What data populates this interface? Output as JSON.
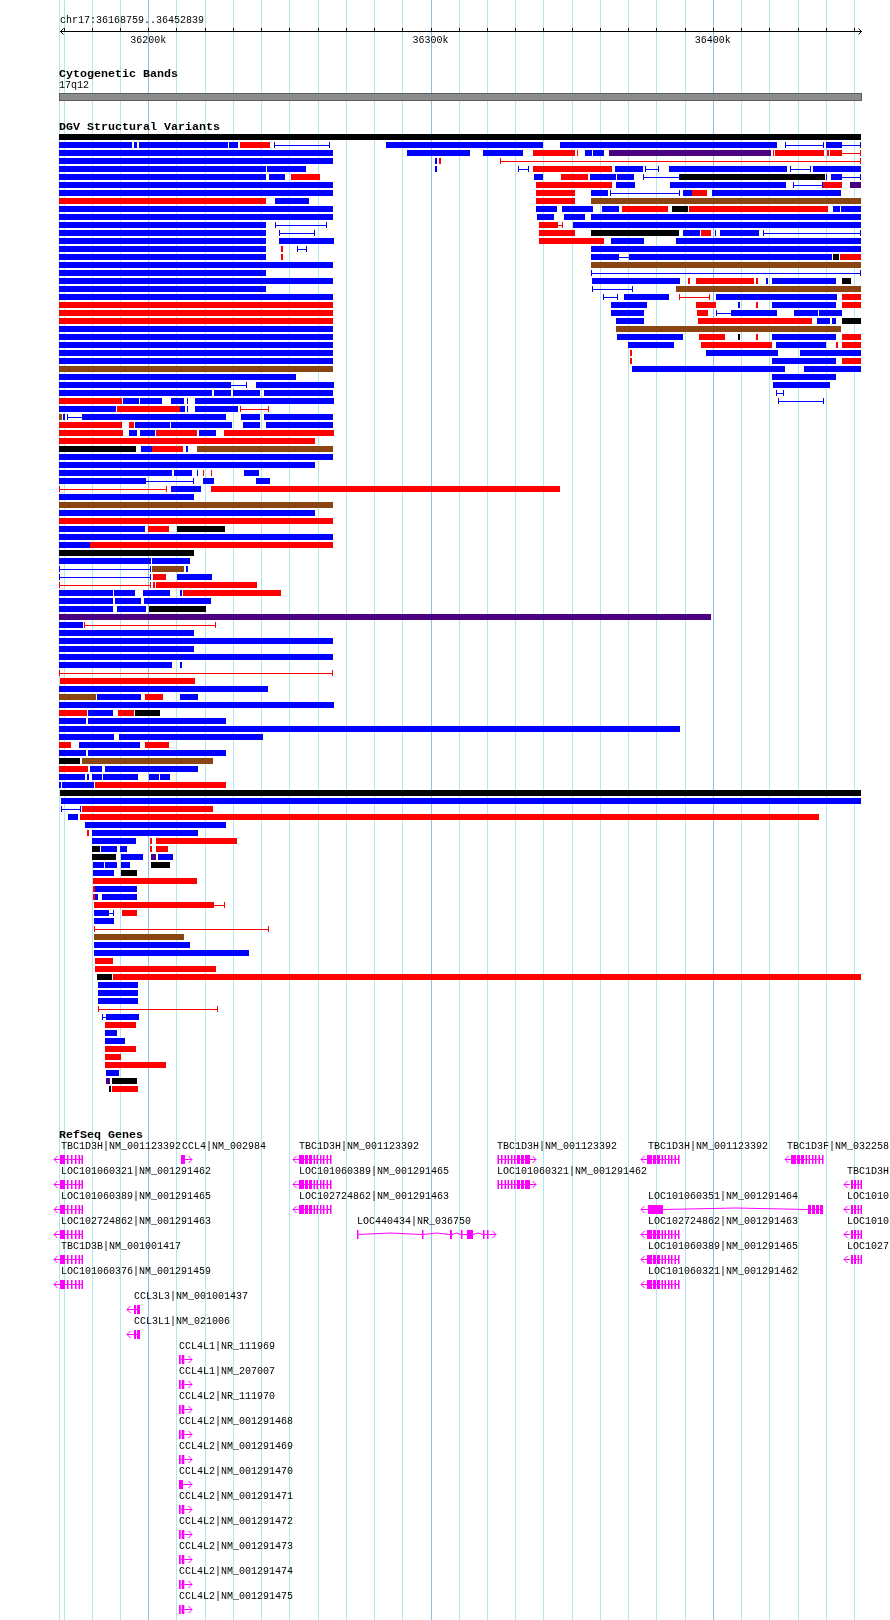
{
  "ruler": {
    "position": "chr17:36168759..36452839",
    "ticks": [
      "36200k",
      "36300k",
      "36400k"
    ]
  },
  "cytogenetic_bands": {
    "title": "Cytogenetic Bands",
    "band": "17q12"
  },
  "dgv_track": {
    "title": "DGV Structural Variants",
    "series": [
      {
        "color": "#0000ff"
      },
      {
        "color": "#ff0000"
      },
      {
        "color": "#8b4513"
      },
      {
        "color": "#000000"
      },
      {
        "color": "#4b0082"
      }
    ]
  },
  "refseq_genes": {
    "title": "RefSeq Genes",
    "genes": [
      {
        "label": "TBC1D3H|NM_001123392",
        "minus_strand": true
      },
      {
        "label": "CCL4|NM_002984",
        "minus_strand": false
      },
      {
        "label": "TBC1D3H|NM_001123392",
        "minus_strand": true
      },
      {
        "label": "TBC1D3H|NM_001123392",
        "minus_strand": false
      },
      {
        "label": "TBC1D3H|NM_001123392",
        "minus_strand": true
      },
      {
        "label": "TBC1D3F|NM_032258",
        "minus_strand": true
      },
      {
        "label": "LOC101060321|NM_001291462",
        "minus_strand": true
      },
      {
        "label": "LOC101060389|NM_001291465",
        "minus_strand": true
      },
      {
        "label": "LOC101060321|NM_001291462",
        "minus_strand": false
      },
      {
        "label": "TBC1D3H",
        "minus_strand": true
      },
      {
        "label": "LOC101060389|NM_001291465",
        "minus_strand": true
      },
      {
        "label": "LOC102724862|NM_001291463",
        "minus_strand": true
      },
      {
        "label": "LOC101060351|NM_001291464",
        "minus_strand": true
      },
      {
        "label": "LOC1010",
        "minus_strand": true
      },
      {
        "label": "LOC102724862|NM_001291463",
        "minus_strand": true
      },
      {
        "label": "LOC440434|NR_036750",
        "minus_strand": false
      },
      {
        "label": "LOC102724862|NM_001291463",
        "minus_strand": true
      },
      {
        "label": "LOC1010",
        "minus_strand": true
      },
      {
        "label": "TBC1D3B|NM_001001417",
        "minus_strand": true
      },
      {
        "label": "LOC101060389|NM_001291465",
        "minus_strand": true
      },
      {
        "label": "LOC1027",
        "minus_strand": true
      },
      {
        "label": "LOC101060376|NM_001291459",
        "minus_strand": true
      },
      {
        "label": "LOC101060321|NM_001291462",
        "minus_strand": true
      },
      {
        "label": "CCL3L3|NM_001001437",
        "minus_strand": true
      },
      {
        "label": "CCL3L1|NM_021006",
        "minus_strand": true
      },
      {
        "label": "CCL4L1|NR_111969",
        "minus_strand": false
      },
      {
        "label": "CCL4L1|NM_207007",
        "minus_strand": false
      },
      {
        "label": "CCL4L2|NR_111970",
        "minus_strand": false
      },
      {
        "label": "CCL4L2|NM_001291468",
        "minus_strand": false
      },
      {
        "label": "CCL4L2|NM_001291469",
        "minus_strand": false
      },
      {
        "label": "CCL4L2|NM_001291470",
        "minus_strand": false
      },
      {
        "label": "CCL4L2|NM_001291471",
        "minus_strand": false
      },
      {
        "label": "CCL4L2|NM_001291472",
        "minus_strand": false
      },
      {
        "label": "CCL4L2|NM_001291473",
        "minus_strand": false
      },
      {
        "label": "CCL4L2|NM_001291474",
        "minus_strand": false
      },
      {
        "label": "CCL4L2|NM_001291475",
        "minus_strand": false
      }
    ]
  }
}
